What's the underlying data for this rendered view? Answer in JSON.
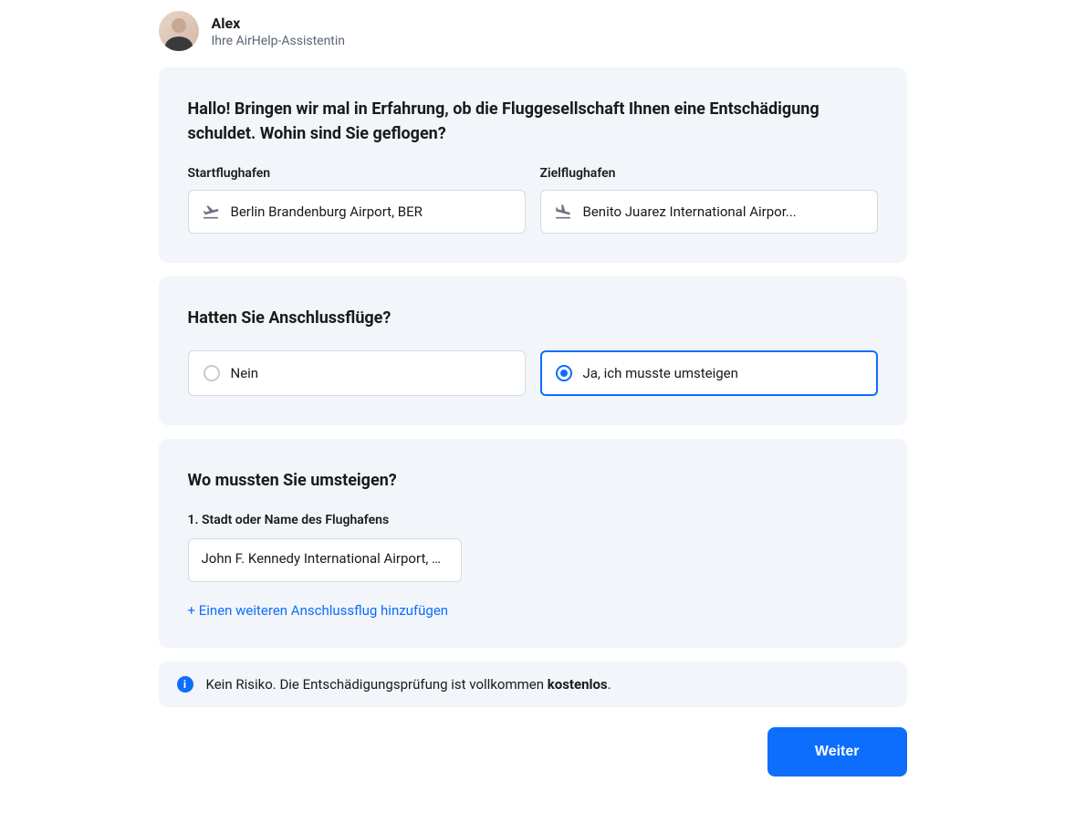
{
  "assistant": {
    "name": "Alex",
    "subtitle": "Ihre AirHelp-Assistentin"
  },
  "card1": {
    "title": "Hallo! Bringen wir mal in Erfahrung, ob die Fluggesellschaft Ihnen eine Entschädigung schuldet. Wohin sind Sie geflogen?",
    "departure_label": "Startflughafen",
    "departure_value": "Berlin Brandenburg Airport, BER",
    "arrival_label": "Zielflughafen",
    "arrival_value": "Benito Juarez International Airpor..."
  },
  "card2": {
    "title": "Hatten Sie Anschlussflüge?",
    "option_no": "Nein",
    "option_yes": "Ja, ich musste umsteigen",
    "selected": "yes"
  },
  "card3": {
    "title": "Wo mussten Sie umsteigen?",
    "sub_label": "1. Stadt oder Name des Flughafens",
    "connection_value": "John F. Kennedy International Airport, J...",
    "add_link": "+ Einen weiteren Anschlussflug hinzufügen"
  },
  "info": {
    "text_prefix": "Kein Risiko. Die Entschädigungsprüfung ist vollkommen ",
    "text_bold": "kostenlos",
    "text_suffix": "."
  },
  "actions": {
    "continue": "Weiter"
  }
}
